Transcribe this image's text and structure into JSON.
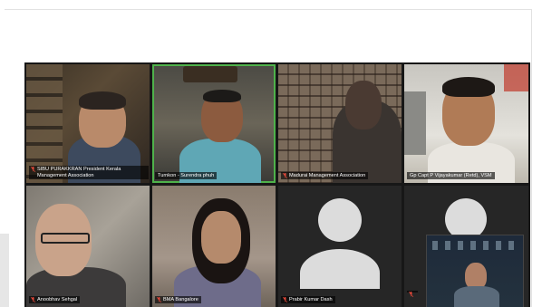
{
  "participants": [
    {
      "name": "SIBU PURAKKRAN President Kerala Management Association",
      "muted": true,
      "active": false
    },
    {
      "name": "Turnkon - Surendra phuh",
      "muted": false,
      "active": true
    },
    {
      "name": "Madurai Management Association",
      "muted": true,
      "active": false
    },
    {
      "name": "Gp Capt P Vijayakumar (Retd), VSM",
      "muted": false,
      "active": false
    },
    {
      "name": "Anoobhav Sehgal",
      "muted": true,
      "active": false
    },
    {
      "name": "BMA Bangalore",
      "muted": true,
      "active": false
    },
    {
      "name": "Prabir Kumar Dash",
      "muted": true,
      "active": false
    },
    {
      "name": "",
      "muted": true,
      "active": false
    }
  ],
  "colors": {
    "active_border": "#4fb24b",
    "mic_muted": "#e8493a",
    "avatar_placeholder": "#dcdcdc",
    "grid_background": "#171717"
  },
  "icons": {
    "mic": "microphone-muted-icon",
    "avatar": "user-avatar-icon"
  }
}
